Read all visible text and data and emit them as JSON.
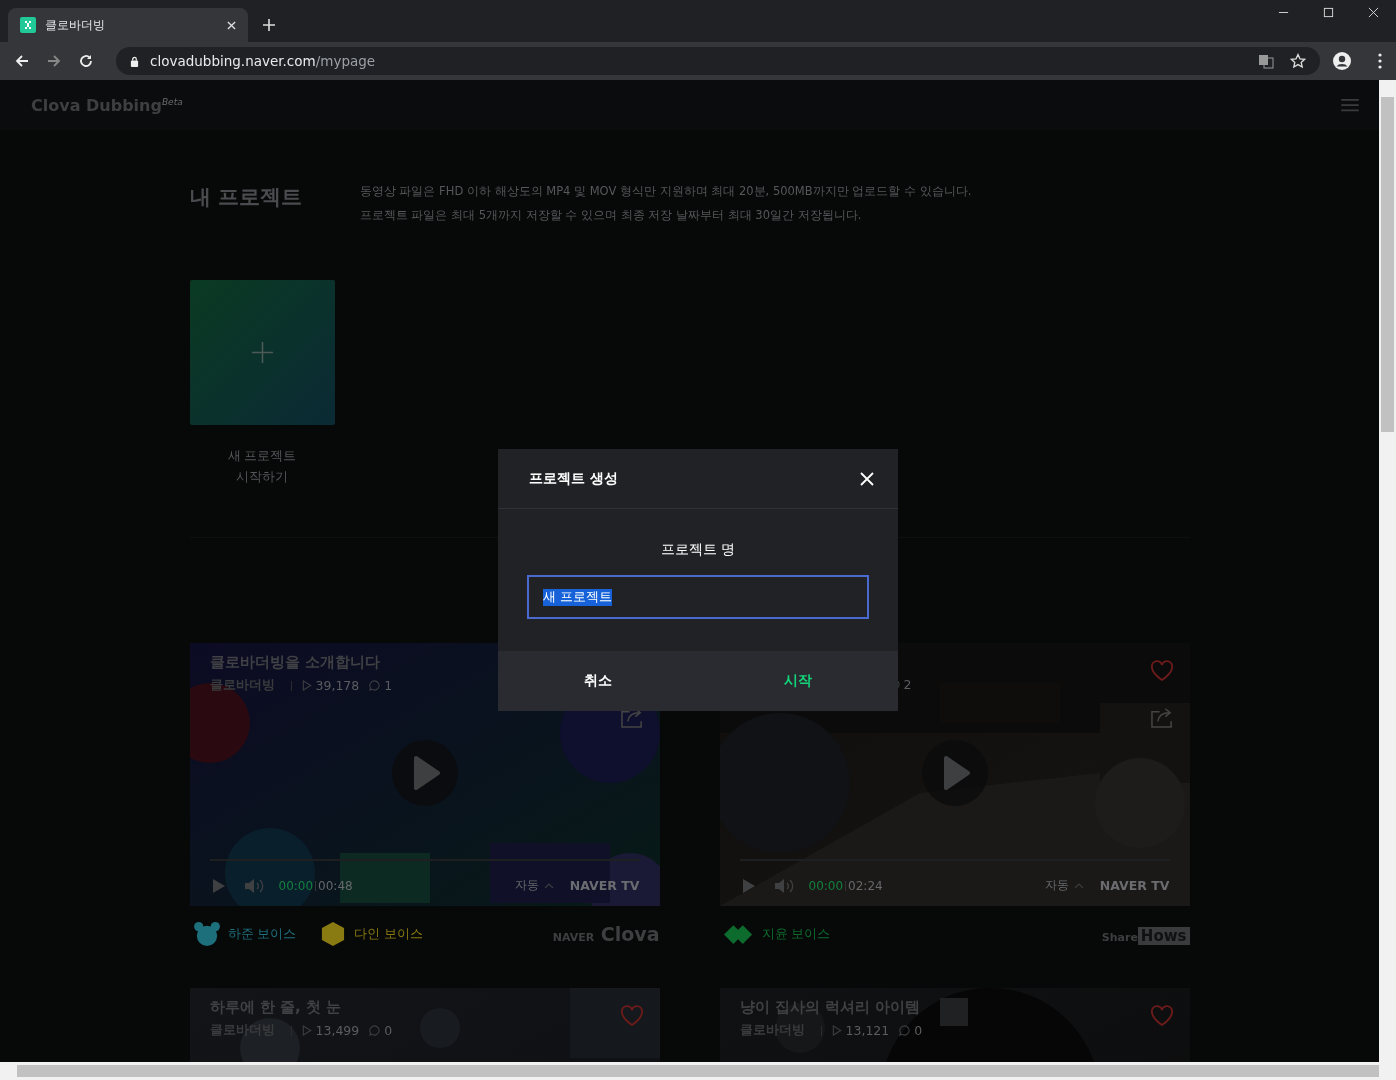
{
  "browser": {
    "tab": {
      "title": "클로바더빙",
      "selected": true
    },
    "url_host": "clovadubbing.naver.com",
    "url_path": "/mypage"
  },
  "header": {
    "logo": "Clova Dubbing",
    "badge": "Beta"
  },
  "projects": {
    "title": "내 프로젝트",
    "notes": [
      "동영상 파일은 FHD 이하 해상도의 MP4 및 MOV 형식만 지원하며 최대 20분, 500MB까지만 업로드할 수 있습니다.",
      "프로젝트 파일은 최대 5개까지 저장할 수 있으며 최종 저장 날짜부터 최대 30일간 저장됩니다."
    ],
    "new_label": "새 프로젝트 시작하기"
  },
  "videos": [
    {
      "title": "클로바더빙을 소개합니다",
      "channel": "클로바더빙",
      "views": "39,178",
      "comments": "1",
      "current": "00:00",
      "duration": "00:48",
      "quality": "자동",
      "source": "NAVER TV",
      "voices": [
        {
          "name": "하준 보이스",
          "kind": "bear",
          "color": "#1d6f7c"
        },
        {
          "name": "다인 보이스",
          "kind": "hexagon",
          "color": "#8a7a12"
        }
      ],
      "partner": {
        "kind": "clova",
        "parts": [
          "NAVER",
          "Clova"
        ]
      }
    },
    {
      "comments": "2",
      "heart": true,
      "current": "00:00",
      "duration": "02:24",
      "quality": "자동",
      "source": "NAVER TV",
      "voices": [
        {
          "name": "지윤 보이스",
          "kind": "rings",
          "color": "#0d6b2e"
        }
      ],
      "partner": {
        "kind": "sharehows",
        "parts": [
          "Share",
          "Hows"
        ]
      }
    },
    {
      "title": "하루에 한 줄, 첫 눈",
      "channel": "클로바더빙",
      "views": "13,499",
      "comments": "0",
      "heart": true
    },
    {
      "title": "냥이 집사의 럭셔리 아이템",
      "channel": "클로바더빙",
      "views": "13,121",
      "comments": "0",
      "heart": true
    }
  ],
  "dialog": {
    "title": "프로젝트 생성",
    "field_label": "프로젝트 명",
    "value": "새 프로젝트",
    "text_selected": true,
    "buttons": [
      {
        "label": "취소",
        "kind": "cancel"
      },
      {
        "label": "시작",
        "kind": "confirm"
      }
    ]
  }
}
